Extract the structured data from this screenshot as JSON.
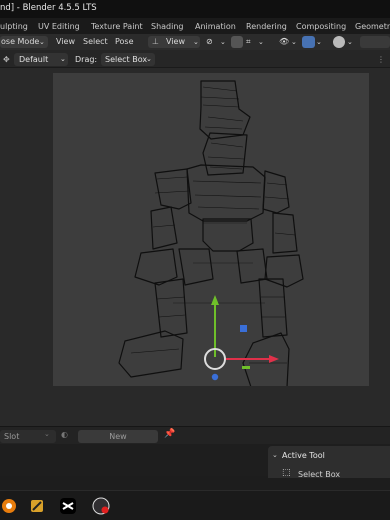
{
  "window": {
    "title": "nd] - Blender 4.5.5 LTS"
  },
  "workspace_tabs": [
    "ulpting",
    "UV Editing",
    "Texture Paint",
    "Shading",
    "Animation",
    "Rendering",
    "Compositing",
    "Geometry"
  ],
  "viewport_header": {
    "mode": "ose Mode",
    "menus": [
      "View",
      "Select",
      "Pose"
    ],
    "orientation": "View"
  },
  "tool_header": {
    "orientation_label": "Default",
    "drag_label": "Drag:",
    "drag_value": "Select Box"
  },
  "timeline": {
    "slot_label": "Slot",
    "new_label": "New"
  },
  "active_tool_panel": {
    "title": "Active Tool",
    "tool": "Select Box"
  },
  "colors": {
    "accent_blue": "#4772b3",
    "gizmo_x": "#e0314a",
    "gizmo_y": "#6fbf2a",
    "gizmo_z": "#3a6fd8"
  }
}
